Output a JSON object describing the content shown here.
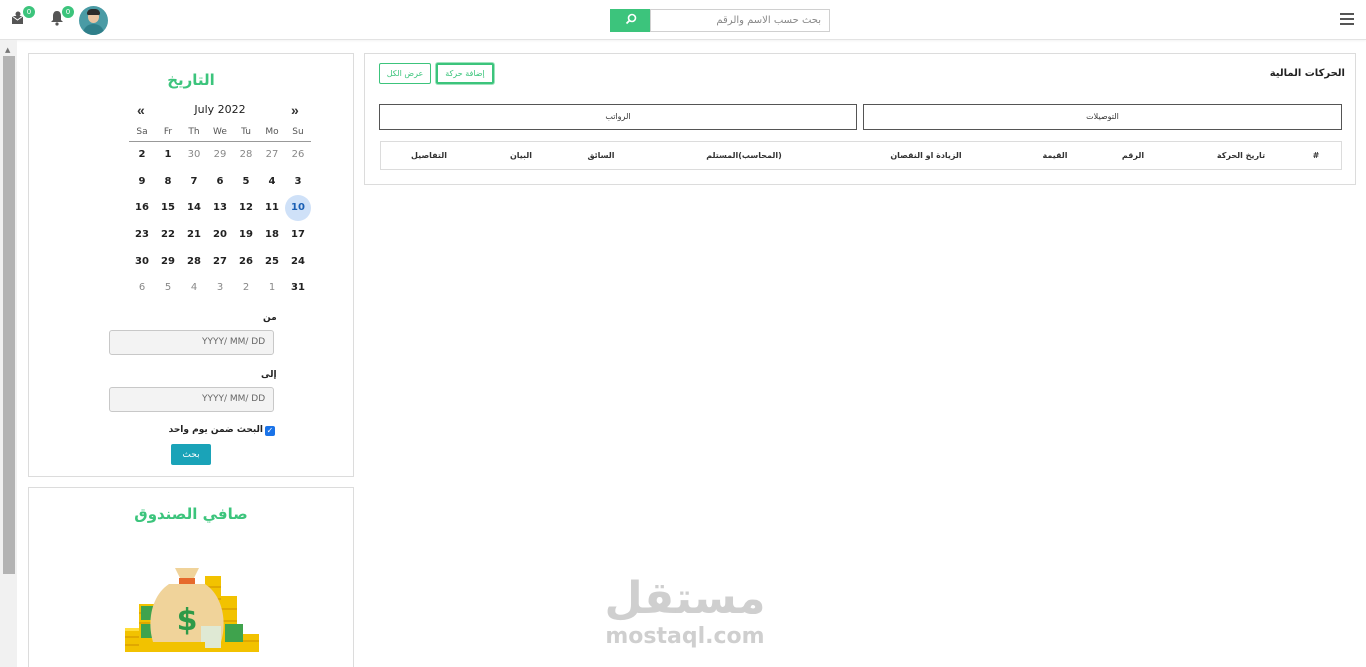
{
  "topbar": {
    "messages_badge": "0",
    "notifications_badge": "0",
    "search_placeholder": "بحث حسب الاسم والرقم"
  },
  "calendar_panel": {
    "title": "التاريخ",
    "prev_nav": "«",
    "next_nav": "»",
    "month_label": "July 2022",
    "weekdays": [
      "Sa",
      "Fr",
      "Th",
      "We",
      "Tu",
      "Mo",
      "Su"
    ],
    "weeks": [
      [
        "2",
        "1",
        "30",
        "29",
        "28",
        "27",
        "26"
      ],
      [
        "9",
        "8",
        "7",
        "6",
        "5",
        "4",
        "3"
      ],
      [
        "16",
        "15",
        "14",
        "13",
        "12",
        "11",
        "10"
      ],
      [
        "23",
        "22",
        "21",
        "20",
        "19",
        "18",
        "17"
      ],
      [
        "30",
        "29",
        "28",
        "27",
        "26",
        "25",
        "24"
      ],
      [
        "6",
        "5",
        "4",
        "3",
        "2",
        "1",
        "31"
      ]
    ],
    "muted_days": [
      "0-2",
      "0-3",
      "0-4",
      "0-5",
      "0-6",
      "5-0",
      "5-1",
      "5-2",
      "5-3",
      "5-4",
      "5-5"
    ],
    "today": "2-6",
    "from_label": "من",
    "from_placeholder": "YYYY/ MM/ DD",
    "to_label": "إلى",
    "to_placeholder": "YYYY/ MM/ DD",
    "single_day_label": "البحث ضمن يوم واحد",
    "single_day_checked": true,
    "search_button": "بحث"
  },
  "cash_panel": {
    "title": "صافي الصندوق"
  },
  "main": {
    "title": "الحركات المالية",
    "show_all_button": "عرض الكل",
    "add_movement_button": "إضافة حركة",
    "tab_receipts": "التوصيلات",
    "tab_salaries": "الرواتب",
    "columns": [
      "#",
      "تاريخ الحركة",
      "الرقم",
      "القيمة",
      "الزيادة او النقصان",
      "(المحاسب)المستلم",
      "السائق",
      "البيان",
      "التفاصيل"
    ]
  },
  "watermark": {
    "arabic": "مستقل",
    "latin": "mostaql.com"
  },
  "colors": {
    "accent_green": "#3cc47c",
    "button_teal": "#1aa3b8",
    "today_highlight": "#cfe1f8"
  }
}
